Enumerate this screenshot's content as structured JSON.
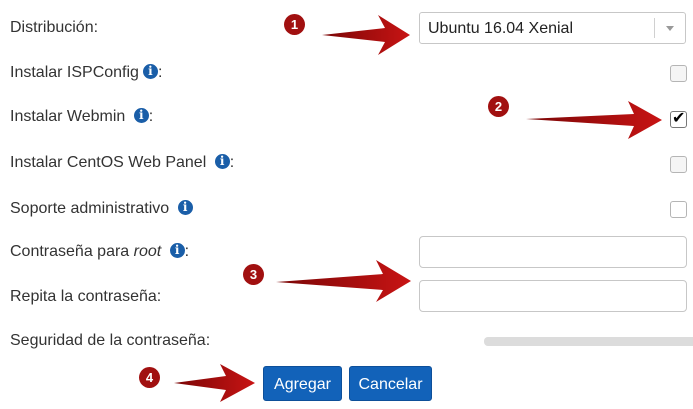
{
  "form": {
    "distribution_label": "Distribución:",
    "distribution_value": "Ubuntu 16.04 Xenial",
    "ispconfig_label": "Instalar ISPConfig",
    "webmin_label": "Instalar Webmin",
    "centos_panel_label": "Instalar CentOS Web Panel",
    "admin_support_label": "Soporte administrativo",
    "root_password_label_prefix": "Contraseña para ",
    "root_password_label_em": "root",
    "repeat_password_label": "Repita la contraseña:",
    "strength_label": "Seguridad de la contraseña:",
    "colon": ":",
    "info_glyph": "i",
    "ispconfig_checked": false,
    "webmin_checked": true,
    "centos_panel_checked": false,
    "admin_support_checked": false
  },
  "buttons": {
    "add_label": "Agregar",
    "cancel_label": "Cancelar"
  },
  "annotations": {
    "badges": [
      "1",
      "2",
      "3",
      "4"
    ],
    "color": "#a11010"
  },
  "colors": {
    "button": "#1262b9",
    "info_icon": "#1a5ea8"
  }
}
